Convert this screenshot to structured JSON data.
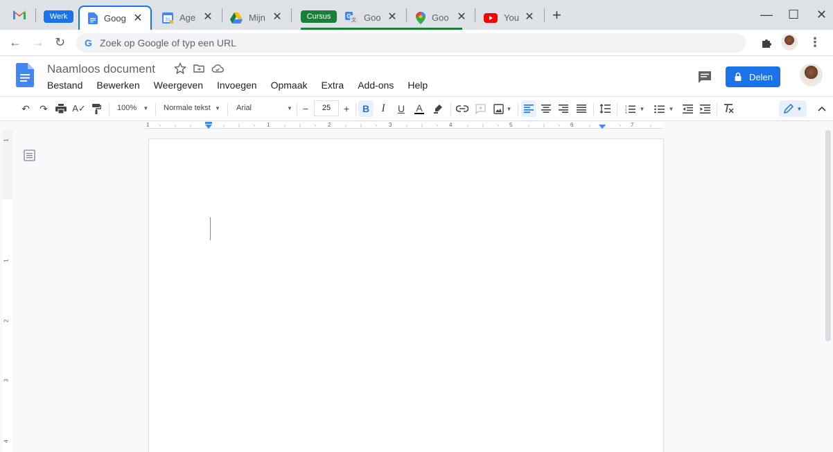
{
  "browser": {
    "tab_groups": [
      {
        "label": "Werk",
        "color": "#1a73e8"
      },
      {
        "label": "Cursus",
        "color": "#188038"
      }
    ],
    "tabs": [
      {
        "title": "Goog",
        "icon": "docs-icon",
        "active": true
      },
      {
        "title": "Age",
        "icon": "calendar-icon"
      },
      {
        "title": "Mijn",
        "icon": "drive-icon"
      },
      {
        "title": "Goo",
        "icon": "translate-icon"
      },
      {
        "title": "Goo",
        "icon": "maps-icon"
      },
      {
        "title": "You",
        "icon": "youtube-icon"
      }
    ],
    "omnibox_placeholder": "Zoek op Google of typ een URL"
  },
  "doc": {
    "title": "Naamloos document",
    "menu": [
      "Bestand",
      "Bewerken",
      "Weergeven",
      "Invoegen",
      "Opmaak",
      "Extra",
      "Add-ons",
      "Help"
    ],
    "share_label": "Delen"
  },
  "toolbar": {
    "zoom": "100%",
    "style": "Normale tekst",
    "font": "Arial",
    "font_size": "25"
  },
  "ruler": {
    "h_numbers": [
      "1",
      "1",
      "2",
      "3",
      "4",
      "5",
      "6",
      "7"
    ],
    "v_numbers": [
      "1",
      "1",
      "2",
      "3",
      "4"
    ]
  },
  "colors": {
    "accent": "#1a73e8",
    "werk_group": "#1a73e8",
    "cursus_group": "#188038"
  }
}
